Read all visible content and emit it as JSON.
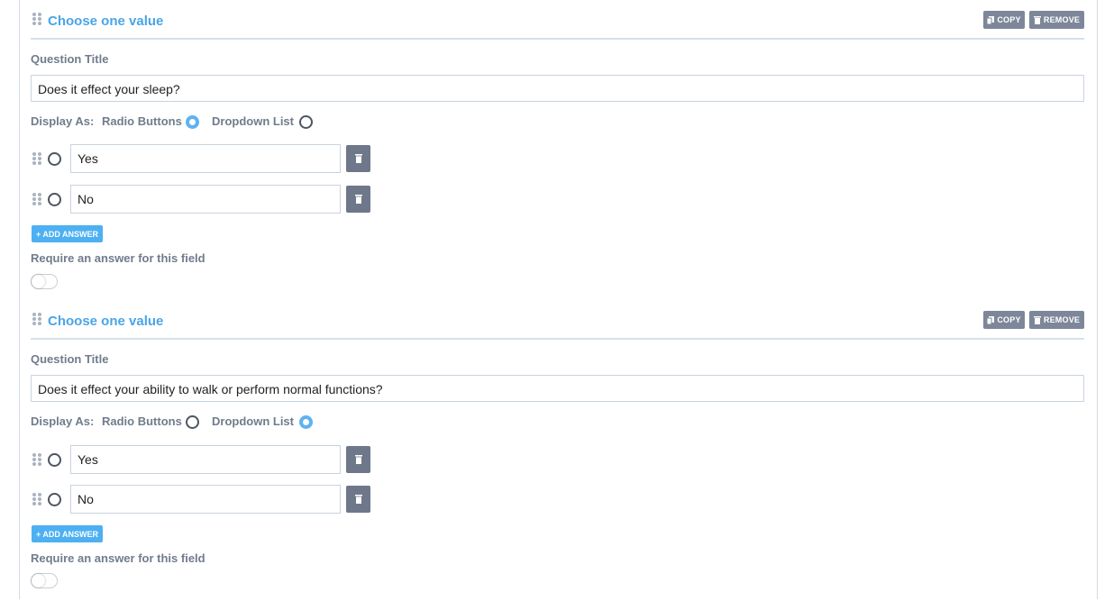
{
  "colors": {
    "accent": "#4aa5e8",
    "button_gray": "#7d8799",
    "add_button": "#4db0f2"
  },
  "questions": [
    {
      "header_title": "Choose one value",
      "copy_label": "COPY",
      "remove_label": "REMOVE",
      "question_title_label": "Question Title",
      "question_title_value": "Does it effect your sleep?",
      "display_as_label": "Display As:",
      "radio_buttons_label": "Radio Buttons",
      "dropdown_list_label": "Dropdown List",
      "display_selected": "Radio Buttons",
      "answers": [
        {
          "value": "Yes"
        },
        {
          "value": "No"
        }
      ],
      "add_answer_label": "+ ADD ANSWER",
      "require_label": "Require an answer for this field",
      "require_enabled": false
    },
    {
      "header_title": "Choose one value",
      "copy_label": "COPY",
      "remove_label": "REMOVE",
      "question_title_label": "Question Title",
      "question_title_value": "Does it effect your ability to walk or perform normal functions?",
      "display_as_label": "Display As:",
      "radio_buttons_label": "Radio Buttons",
      "dropdown_list_label": "Dropdown List",
      "display_selected": "Dropdown List",
      "answers": [
        {
          "value": "Yes"
        },
        {
          "value": "No"
        }
      ],
      "add_answer_label": "+ ADD ANSWER",
      "require_label": "Require an answer for this field",
      "require_enabled": false
    }
  ]
}
